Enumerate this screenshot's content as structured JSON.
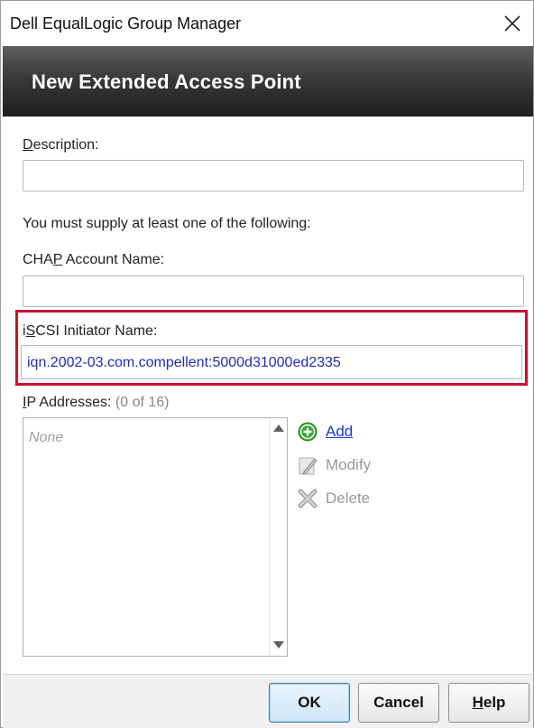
{
  "window": {
    "title": "Dell EqualLogic Group Manager",
    "close_glyph": "✕"
  },
  "banner": {
    "title": "New Extended Access Point"
  },
  "form": {
    "description_label_mn": "D",
    "description_label_rest": "escription:",
    "description_value": "",
    "notice": "You must supply at least one of the following:",
    "chap_label_pre": "CHA",
    "chap_label_mn": "P",
    "chap_label_rest": " Account Name:",
    "chap_value": "",
    "iscsi_label_pre": "i",
    "iscsi_label_mn": "S",
    "iscsi_label_rest": "CSI Initiator Name:",
    "iscsi_value": "iqn.2002-03.com.compellent:5000d31000ed2335",
    "ip_label_mn": "I",
    "ip_label_rest": "P Addresses:",
    "ip_count": "(0 of 16)",
    "ip_list_empty": "None"
  },
  "actions": {
    "add": "Add",
    "modify": "Modify",
    "delete": "Delete"
  },
  "buttons": {
    "ok": "OK",
    "cancel": "Cancel",
    "help_mn": "H",
    "help_rest": "elp"
  },
  "colors": {
    "highlight": "#c8102e",
    "link": "#1a3cc8",
    "iscsi_text": "#1f2fb0",
    "add_icon": "#3aa63a"
  },
  "icons": {
    "add": "plus-circle-icon",
    "modify": "pencil-icon",
    "delete": "x-icon",
    "close": "close-icon"
  }
}
